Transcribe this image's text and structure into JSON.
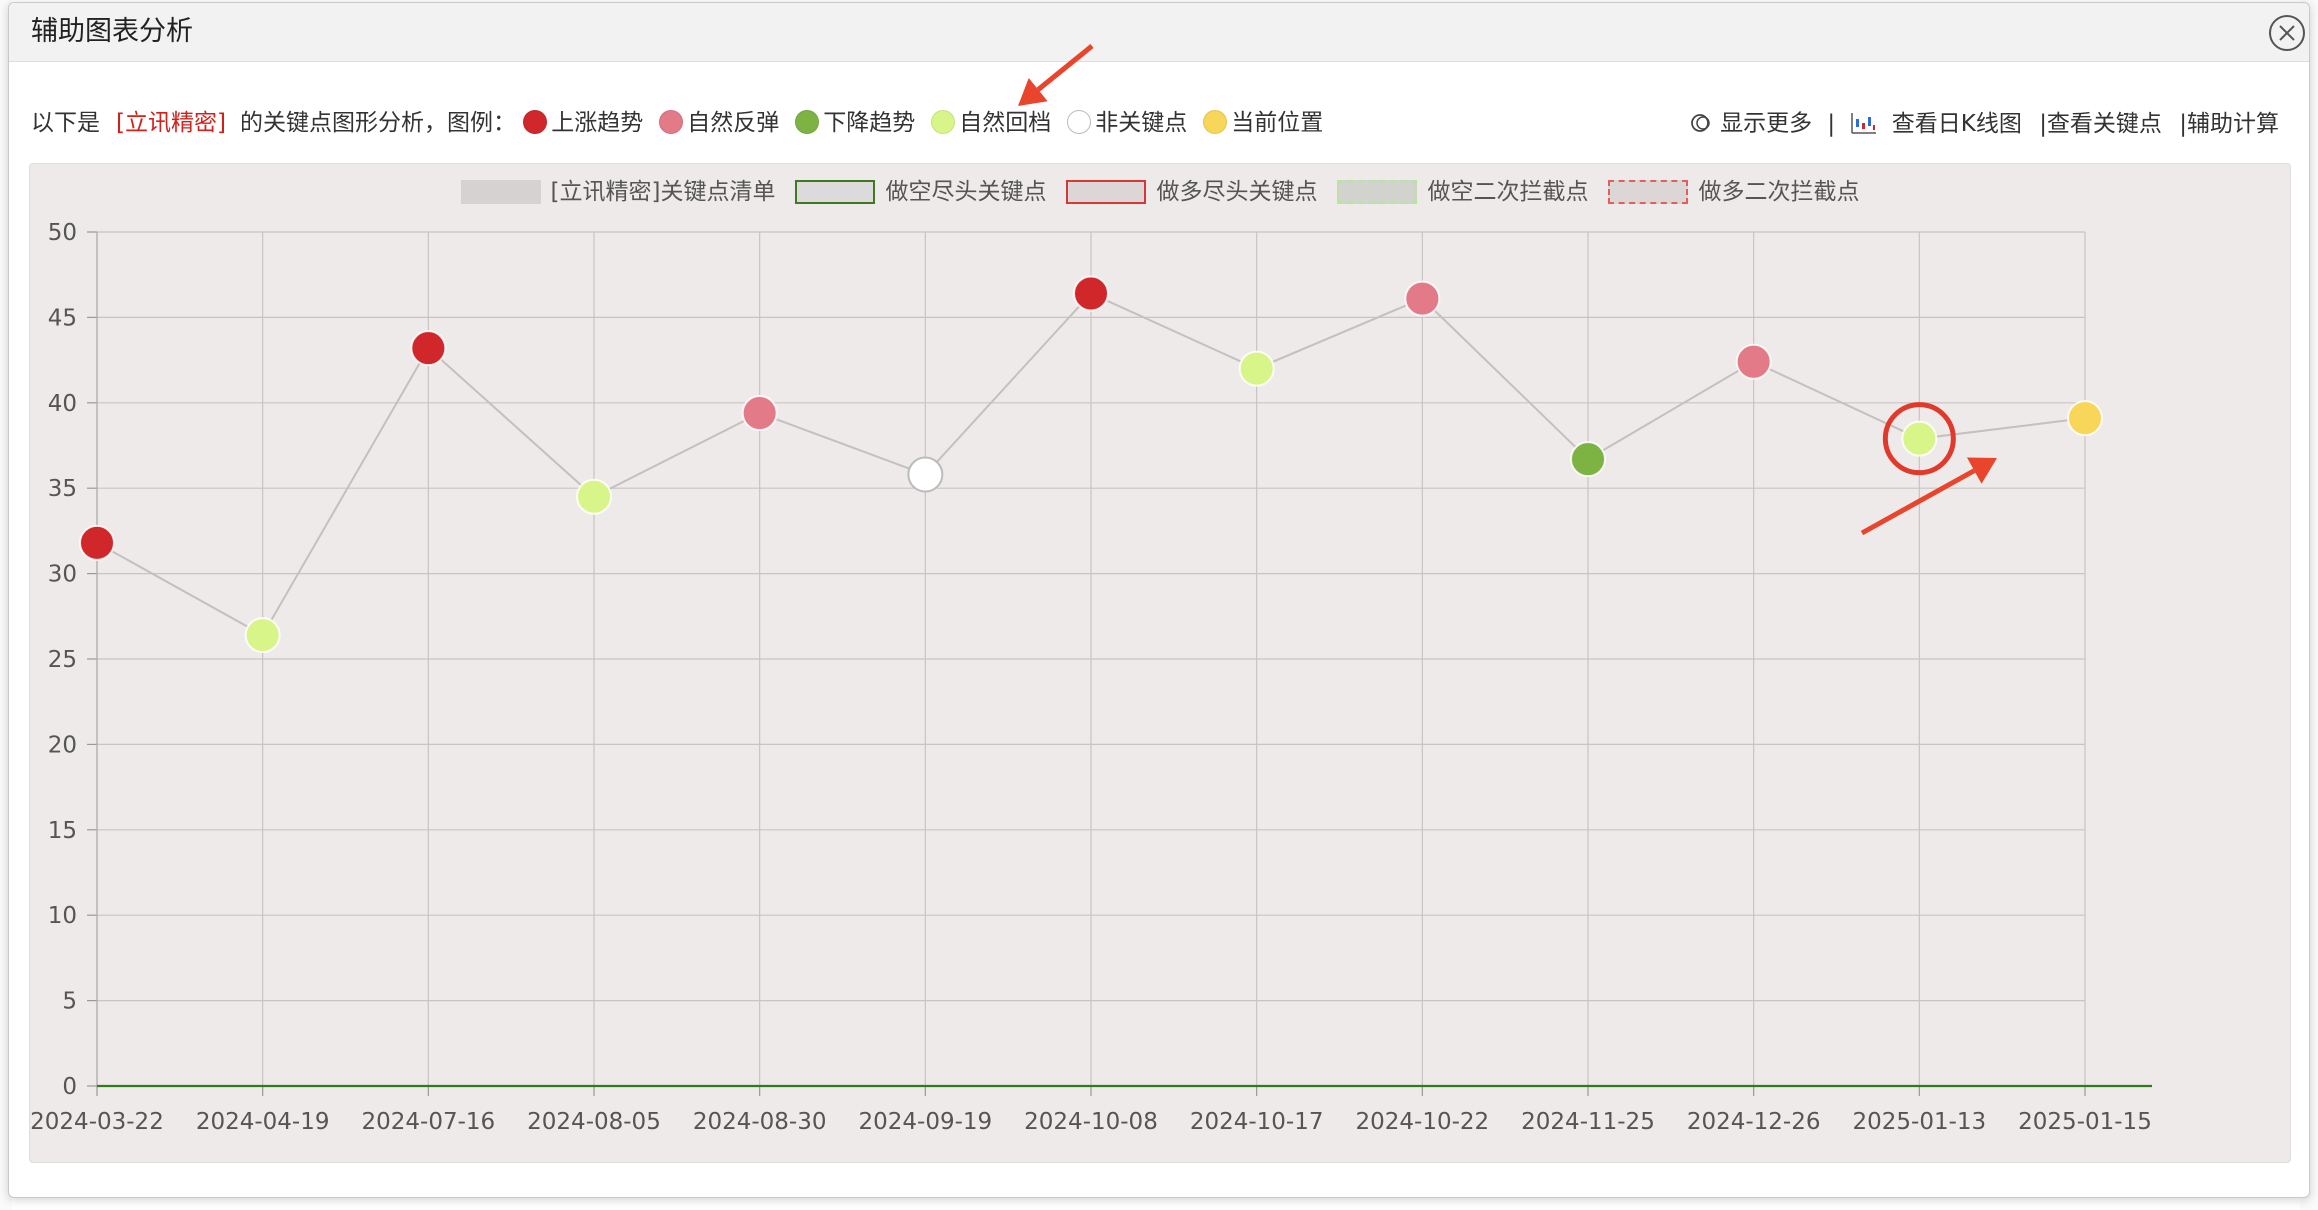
{
  "dialog": {
    "title": "辅助图表分析"
  },
  "legend": {
    "prefix": "以下是",
    "stock": "[立讯精密]",
    "suffix": "的关键点图形分析，图例：",
    "items": [
      {
        "label": "上涨趋势",
        "color": "#d0282a"
      },
      {
        "label": "自然反弹",
        "color": "#e27a88"
      },
      {
        "label": "下降趋势",
        "color": "#7cb342"
      },
      {
        "label": "自然回档",
        "color": "#d8f58a"
      },
      {
        "label": "非关键点",
        "color": "#ffffff"
      },
      {
        "label": "当前位置",
        "color": "#f7d659"
      }
    ]
  },
  "tools": {
    "show_more": "显示更多",
    "sep": "|",
    "daily_k": "查看日K线图",
    "view_keypoints": "|查看关键点",
    "calc": "|辅助计算"
  },
  "chart_legend": [
    {
      "label": "[立讯精密]关键点清单",
      "fill": "#d6d2d2",
      "border": "#d6d2d2",
      "dash": false
    },
    {
      "label": "做空尽头关键点",
      "fill": "#dcdada",
      "border": "#3d7a20",
      "dash": false
    },
    {
      "label": "做多尽头关键点",
      "fill": "#dcd6d6",
      "border": "#d43a33",
      "dash": false
    },
    {
      "label": "做空二次拦截点",
      "fill": "#d2d2cf",
      "border": "#b8e59a",
      "dash": true
    },
    {
      "label": "做多二次拦截点",
      "fill": "#dcd6d6",
      "border": "#e06060",
      "dash": true
    }
  ],
  "chart_data": {
    "type": "line",
    "title": "",
    "xlabel": "",
    "ylabel": "",
    "ylim": [
      0,
      50
    ],
    "yticks": [
      0,
      5,
      10,
      15,
      20,
      25,
      30,
      35,
      40,
      45,
      50
    ],
    "grid": true,
    "legend_position": "top-center",
    "categories": [
      "2024-03-22",
      "2024-04-19",
      "2024-07-16",
      "2024-08-05",
      "2024-08-30",
      "2024-09-19",
      "2024-10-08",
      "2024-10-17",
      "2024-10-22",
      "2024-11-25",
      "2024-12-26",
      "2025-01-13",
      "2025-01-15"
    ],
    "series": [
      {
        "name": "[立讯精密]关键点清单",
        "values": [
          31.8,
          26.4,
          43.2,
          34.5,
          39.4,
          35.8,
          46.4,
          42.0,
          46.1,
          36.7,
          42.4,
          37.9,
          39.1
        ],
        "point_types": [
          "上涨趋势",
          "自然回档",
          "上涨趋势",
          "自然回档",
          "自然反弹",
          "非关键点",
          "上涨趋势",
          "自然回档",
          "自然反弹",
          "下降趋势",
          "自然反弹",
          "自然回档",
          "当前位置"
        ]
      },
      {
        "name": "做空尽头关键点",
        "values": [
          0,
          0,
          0,
          0,
          0,
          0,
          0,
          0,
          0,
          0,
          0,
          0,
          0
        ]
      }
    ],
    "point_colors": {
      "上涨趋势": "#d0282a",
      "自然反弹": "#e27a88",
      "下降趋势": "#7cb342",
      "自然回档": "#d8f58a",
      "非关键点": "#ffffff",
      "当前位置": "#f7d659"
    },
    "line_color": "#c4c0c0",
    "baseline_color": "#2f7a1a",
    "grid_color": "#c8c4c4",
    "highlight_index": 11,
    "highlight_color": "#e03a2c"
  },
  "annotation_color": "#e8452c"
}
